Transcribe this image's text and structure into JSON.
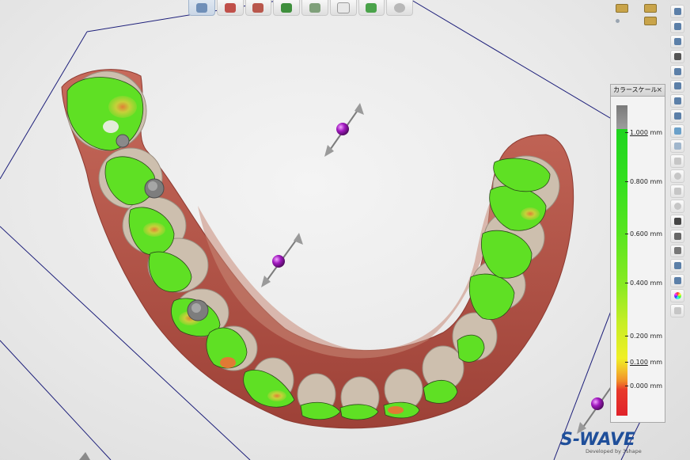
{
  "toolbar": {
    "tools": [
      {
        "icon": "scan-view-icon",
        "active": true
      },
      {
        "icon": "trim-scissors-icon",
        "active": false
      },
      {
        "icon": "crown-red-icon",
        "active": false
      },
      {
        "icon": "crown-green-icon",
        "active": false
      },
      {
        "icon": "crown-gray-icon",
        "active": false
      },
      {
        "icon": "tooth-outline-icon",
        "active": false
      },
      {
        "icon": "tooth-check-icon",
        "active": false
      },
      {
        "icon": "sphere-icon",
        "active": false
      }
    ]
  },
  "right_toolbar": {
    "icons": [
      {
        "icon": "close-icon",
        "dim": false
      },
      {
        "icon": "fit-view-icon",
        "dim": false
      },
      {
        "icon": "rotate-icon",
        "dim": false
      },
      {
        "icon": "bite-icon",
        "dim": false
      },
      {
        "icon": "layer-icon",
        "dim": false
      },
      {
        "icon": "layer-icon",
        "dim": false
      },
      {
        "icon": "layer-icon",
        "dim": false
      },
      {
        "icon": "layer-icon",
        "dim": false
      },
      {
        "icon": "model-icon",
        "dim": false
      },
      {
        "icon": "model-icon",
        "dim": false
      },
      {
        "icon": "transparency-icon",
        "dim": true
      },
      {
        "icon": "sphere-icon",
        "dim": true
      },
      {
        "icon": "warning-icon",
        "dim": true
      },
      {
        "icon": "sphere-icon",
        "dim": true
      },
      {
        "icon": "camera-icon",
        "dim": false
      },
      {
        "icon": "gem-icon",
        "dim": false
      },
      {
        "icon": "axis-icon",
        "dim": false
      },
      {
        "icon": "ruler-icon",
        "dim": false
      },
      {
        "icon": "scan-person-icon",
        "dim": false
      },
      {
        "icon": "color-wheel-icon",
        "dim": false
      },
      {
        "icon": "snapshot-icon",
        "dim": true
      }
    ]
  },
  "color_scale": {
    "title": "カラースケール",
    "close": "×",
    "labels": [
      {
        "value": "1.000",
        "unit": "mm",
        "underline": true
      },
      {
        "value": "0.800",
        "unit": "mm",
        "underline": false
      },
      {
        "value": "0.600",
        "unit": "mm",
        "underline": false
      },
      {
        "value": "0.400",
        "unit": "mm",
        "underline": false
      },
      {
        "value": "0.200",
        "unit": "mm",
        "underline": false
      },
      {
        "value": "0.100",
        "unit": "mm",
        "underline": true
      },
      {
        "value": "0.000",
        "unit": "mm",
        "underline": false
      }
    ]
  },
  "logo": {
    "main": "S-WAVE",
    "sub": "Developed by 3shape"
  },
  "colors": {
    "gingiva": "#b9574c",
    "tooth": "#cbb9a4",
    "contact_green": "#5fe024",
    "contact_yellow": "#d8d33a",
    "contact_orange": "#e07a34",
    "handle_purple": "#9a16b5",
    "bbox_lines": "#1d1f7a"
  }
}
